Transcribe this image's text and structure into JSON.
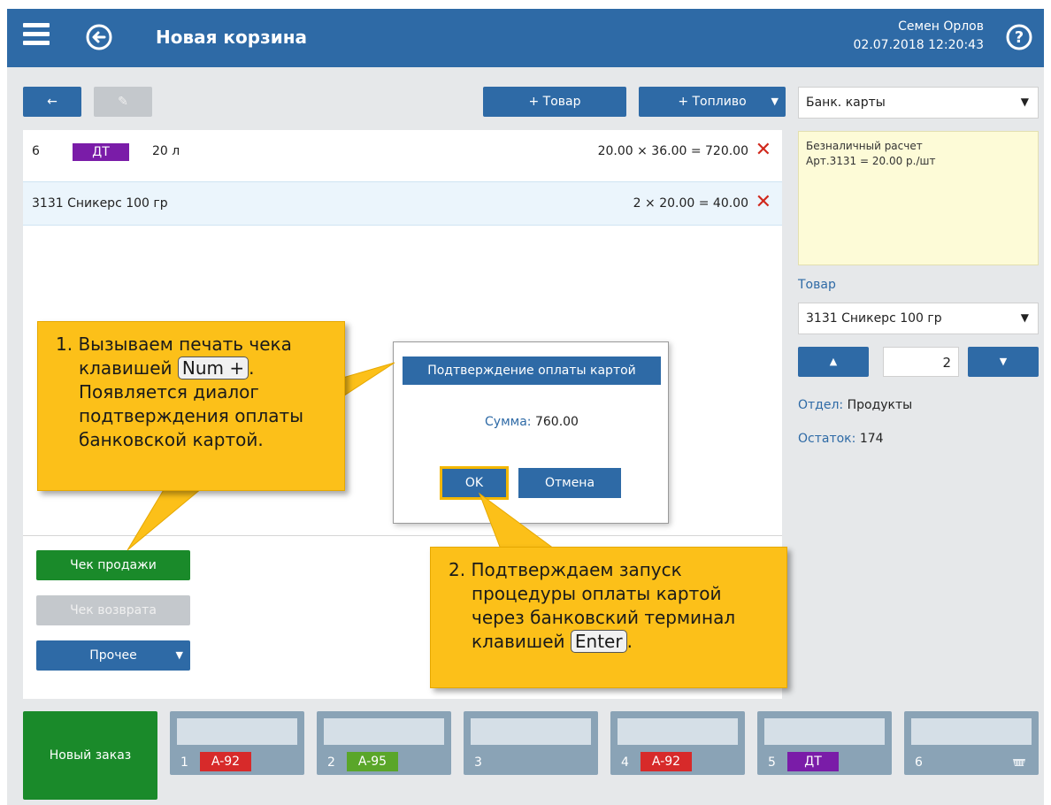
{
  "header": {
    "title": "Новая корзина",
    "user": "Семен Орлов",
    "datetime": "02.07.2018 12:20:43"
  },
  "toolbar": {
    "back_label": "←",
    "edit_label": "✎",
    "add_product_label": "+ Товар",
    "add_fuel_label": "+ Топливо",
    "fuel_caret": "▼"
  },
  "cart": {
    "rows": [
      {
        "id": "6",
        "tag": "ДТ",
        "tag_color": "#7a1ca8",
        "name": "20 л",
        "calc": "20.00 × 36.00 =  720.00"
      },
      {
        "id": "",
        "name": "3131 Сникерс 100 гр",
        "calc": "2 × 20.00 =   40.00",
        "selected": true
      }
    ]
  },
  "actions": {
    "sale_receipt": "Чек продажи",
    "return_receipt": "Чек возврата",
    "other": "Прочее"
  },
  "right": {
    "payment_select": "Банк. карты",
    "note_line1": "Безналичный расчет",
    "note_line2": "Арт.3131 = 20.00 р./шт",
    "product_label": "Товар",
    "product_select": "3131  Сникерс 100 гр",
    "quantity": "2",
    "dept_label": "Отдел:",
    "dept_value": "Продукты",
    "stock_label": "Остаток:",
    "stock_value": "174"
  },
  "dialog": {
    "title": "Подтверждение оплаты картой",
    "sum_label": "Сумма:",
    "sum_value": "760.00",
    "ok": "OK",
    "cancel": "Отмена"
  },
  "callout1": {
    "line1": "1. Вызываем печать чека",
    "line2_pre": "клавишей ",
    "key": "Num +",
    "line2_post": ".",
    "line3": "Появляется диалог",
    "line4": "подтверждения оплаты",
    "line5": "банковской картой."
  },
  "callout2": {
    "line1": "2. Подтверждаем запуск",
    "line2": "процедуры оплаты картой",
    "line3": "через банковский терминал",
    "line4_pre": "клавишей ",
    "key": "Enter",
    "line4_post": "."
  },
  "bottom": {
    "new_order": "Новый заказ",
    "tiles": [
      {
        "num": "1",
        "tag": "A-92",
        "color": "#d72a2a"
      },
      {
        "num": "2",
        "tag": "A-95",
        "color": "#5aa629"
      },
      {
        "num": "3",
        "tag": "",
        "color": ""
      },
      {
        "num": "4",
        "tag": "A-92",
        "color": "#d72a2a"
      },
      {
        "num": "5",
        "tag": "ДТ",
        "color": "#7a1ca8"
      },
      {
        "num": "6",
        "tag": "",
        "color": "",
        "basket": true
      }
    ]
  }
}
